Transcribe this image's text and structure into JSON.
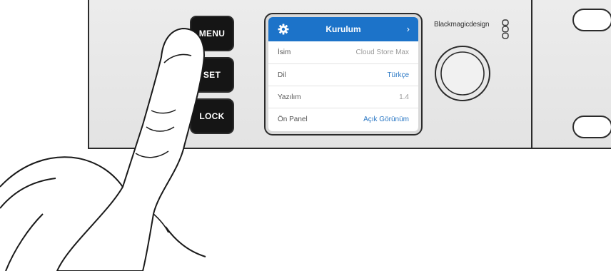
{
  "buttons": {
    "menu": "MENU",
    "set": "SET",
    "lock": "LOCK"
  },
  "lcd": {
    "title": "Kurulum",
    "rows": [
      {
        "label": "İsim",
        "value": "Cloud Store Max"
      },
      {
        "label": "Dil",
        "value": "Türkçe"
      },
      {
        "label": "Yazılım",
        "value": "1.4"
      },
      {
        "label": "Ön Panel",
        "value": "Açık Görünüm"
      }
    ]
  },
  "brand": {
    "name": "Blackmagicdesign"
  },
  "colors": {
    "lcd_header": "#1c73c9",
    "accent_value": "#2a77c4"
  },
  "icons": [
    "gear-icon",
    "chevron-right-icon",
    "blackmagic-logo-icon",
    "rotary-knob",
    "pointing-hand"
  ]
}
